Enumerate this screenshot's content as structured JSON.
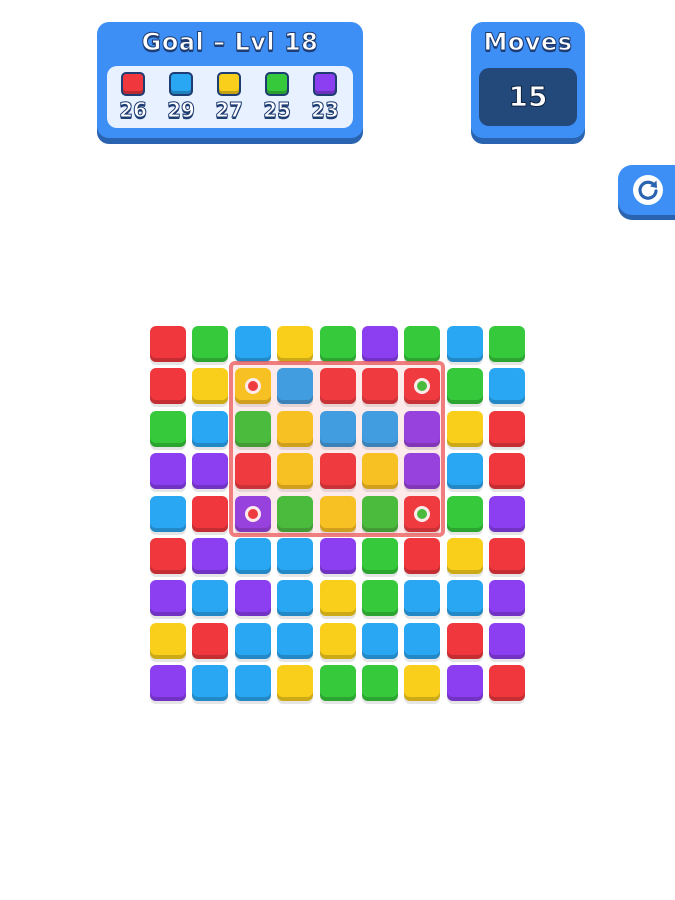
{
  "goal": {
    "title": "Goal – Lvl 18",
    "items": [
      {
        "color": "#f0373d",
        "count": "26"
      },
      {
        "color": "#2aa7f2",
        "count": "29"
      },
      {
        "color": "#f9cf1c",
        "count": "27"
      },
      {
        "color": "#35c93b",
        "count": "25"
      },
      {
        "color": "#8b3ff0",
        "count": "23"
      }
    ]
  },
  "moves": {
    "title": "Moves",
    "value": "15"
  },
  "restart_icon": "restart-icon",
  "palette": {
    "R": "#f0373d",
    "B": "#2aa7f2",
    "Y": "#f9cf1c",
    "G": "#35c93b",
    "P": "#8b3ff0"
  },
  "board": {
    "rows": [
      [
        "R",
        "G",
        "B",
        "Y",
        "G",
        "P",
        "G",
        "B",
        "G"
      ],
      [
        "R",
        "Y",
        "Y",
        "B",
        "R",
        "R",
        "R",
        "G",
        "B"
      ],
      [
        "G",
        "B",
        "G",
        "Y",
        "B",
        "B",
        "P",
        "Y",
        "R"
      ],
      [
        "P",
        "P",
        "R",
        "Y",
        "R",
        "Y",
        "P",
        "B",
        "R"
      ],
      [
        "B",
        "R",
        "P",
        "G",
        "Y",
        "G",
        "R",
        "G",
        "P"
      ],
      [
        "R",
        "P",
        "B",
        "B",
        "P",
        "G",
        "R",
        "Y",
        "R"
      ],
      [
        "P",
        "B",
        "P",
        "B",
        "Y",
        "G",
        "B",
        "B",
        "P"
      ],
      [
        "Y",
        "R",
        "B",
        "B",
        "Y",
        "B",
        "B",
        "R",
        "P"
      ],
      [
        "P",
        "B",
        "B",
        "Y",
        "G",
        "G",
        "Y",
        "P",
        "R"
      ]
    ],
    "markers": [
      {
        "row": 1,
        "col": 2,
        "color": "R"
      },
      {
        "row": 1,
        "col": 6,
        "color": "G"
      },
      {
        "row": 4,
        "col": 2,
        "color": "R"
      },
      {
        "row": 4,
        "col": 6,
        "color": "G"
      }
    ]
  }
}
